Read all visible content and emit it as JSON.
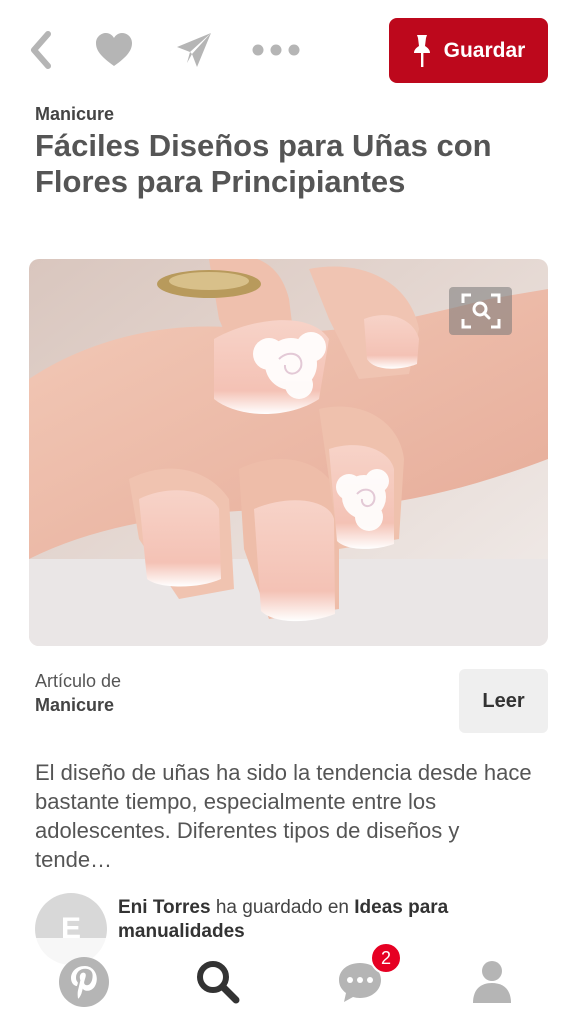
{
  "toolbar": {
    "save_label": "Guardar",
    "icons": [
      "back-icon",
      "heart-icon",
      "send-icon",
      "more-icon",
      "pin-icon"
    ]
  },
  "pin": {
    "category": "Manicure",
    "title": "Fáciles Diseños para Uñas con Flores para Principiantes"
  },
  "article": {
    "label": "Artículo de",
    "source": "Manicure",
    "read_label": "Leer"
  },
  "description": "El diseño de uñas ha sido la tendencia desde hace bastante tiempo, especialmente entre los adolescentes. Diferentes tipos de diseños y tende…",
  "saved_by": {
    "avatar_initial": "E",
    "user": "Eni Torres",
    "action": " ha guardado en ",
    "board": "Ideas para manualidades"
  },
  "bottom_nav": {
    "notification_count": "2",
    "icons": [
      "pinterest-home-icon",
      "search-icon",
      "chat-icon",
      "profile-icon"
    ]
  },
  "colors": {
    "brand_red": "#bd081c",
    "badge_red": "#e60023",
    "icon_gray": "#b5b5b5"
  }
}
